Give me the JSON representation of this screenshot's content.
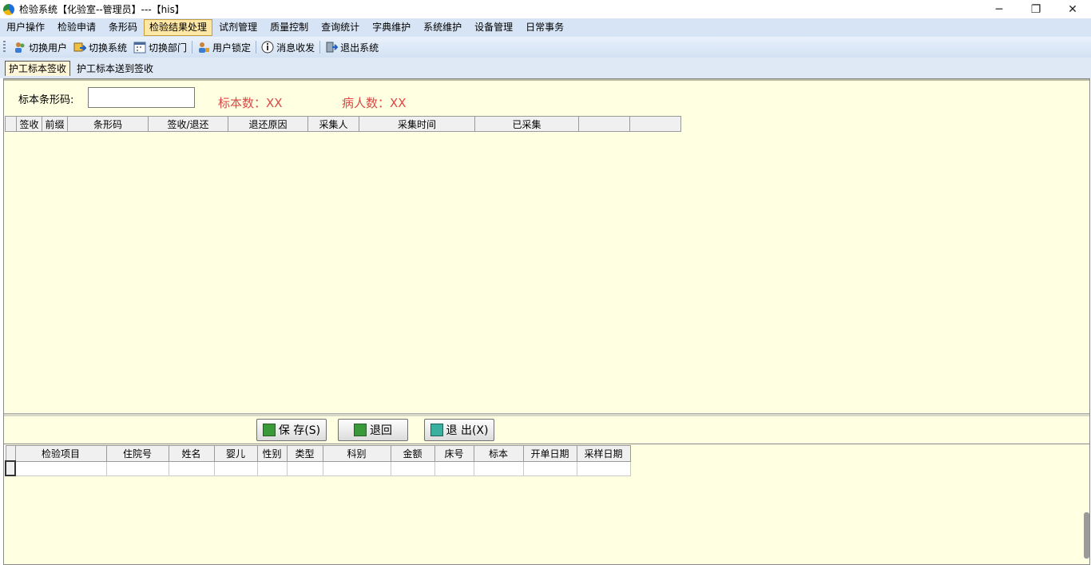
{
  "window": {
    "title": "检验系统【化验室--管理员】---【his】",
    "min_icon": "─",
    "restore_icon": "❐",
    "close_icon": "✕"
  },
  "menu": [
    "用户操作",
    "检验申请",
    "条形码",
    "检验结果处理",
    "试剂管理",
    "质量控制",
    "查询统计",
    "字典维护",
    "系统维护",
    "设备管理",
    "日常事务"
  ],
  "toolbar": {
    "switch_user": "切换用户",
    "switch_system": "切换系统",
    "switch_dept": "切换部门",
    "lock_user": "用户锁定",
    "messages": "消息收发",
    "exit_system": "退出系统"
  },
  "tabs": {
    "tab1": "护工标本签收",
    "tab2": "护工标本送到签收"
  },
  "form": {
    "barcode_label": "标本条形码:",
    "barcode_value": "",
    "specimen_count": "标本数：XX",
    "patient_count": "病人数：XX"
  },
  "grid_top": {
    "columns": [
      "签收",
      "前缀",
      "条形码",
      "签收/退还",
      "退还原因",
      "采集人",
      "采集时间",
      "已采集",
      "",
      ""
    ]
  },
  "buttons": {
    "save": "保 存(S)",
    "return": "退回",
    "exit": "退 出(X)"
  },
  "grid_bottom": {
    "columns": [
      "检验项目",
      "住院号",
      "姓名",
      "婴儿",
      "性别",
      "类型",
      "科别",
      "金额",
      "床号",
      "标本",
      "开单日期",
      "采样日期"
    ]
  },
  "colors": {
    "pane_bg": "#ffffe1",
    "count_red": "#e04646",
    "menu_bg": "#d6e4f5"
  }
}
